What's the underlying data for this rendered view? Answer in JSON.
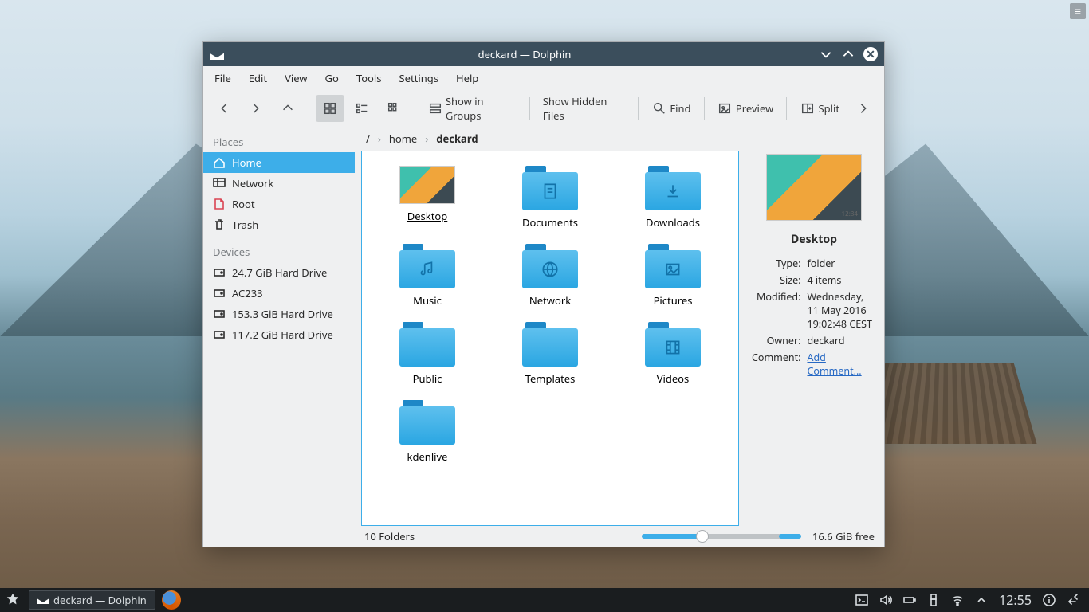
{
  "window": {
    "title": "deckard — Dolphin",
    "menus": [
      "File",
      "Edit",
      "View",
      "Go",
      "Tools",
      "Settings",
      "Help"
    ],
    "toolbar": {
      "show_groups": "Show in Groups",
      "show_hidden": "Show Hidden Files",
      "find": "Find",
      "preview": "Preview",
      "split": "Split"
    },
    "breadcrumbs": [
      "/",
      "home",
      "deckard"
    ]
  },
  "sidebar": {
    "places_header": "Places",
    "places": [
      {
        "label": "Home",
        "icon": "home",
        "selected": true
      },
      {
        "label": "Network",
        "icon": "network"
      },
      {
        "label": "Root",
        "icon": "root",
        "red": true
      },
      {
        "label": "Trash",
        "icon": "trash"
      }
    ],
    "devices_header": "Devices",
    "devices": [
      {
        "label": "24.7 GiB Hard Drive"
      },
      {
        "label": "AC233"
      },
      {
        "label": "153.3 GiB Hard Drive"
      },
      {
        "label": "117.2 GiB Hard Drive"
      }
    ]
  },
  "folders": [
    {
      "label": "Desktop",
      "type": "desktop",
      "selected": true
    },
    {
      "label": "Documents",
      "type": "doc"
    },
    {
      "label": "Downloads",
      "type": "down"
    },
    {
      "label": "Music",
      "type": "music"
    },
    {
      "label": "Network",
      "type": "globe"
    },
    {
      "label": "Pictures",
      "type": "pic"
    },
    {
      "label": "Public",
      "type": "plain"
    },
    {
      "label": "Templates",
      "type": "plain"
    },
    {
      "label": "Videos",
      "type": "video"
    },
    {
      "label": "kdenlive",
      "type": "plain"
    }
  ],
  "details": {
    "title": "Desktop",
    "rows": {
      "type_k": "Type:",
      "type_v": "folder",
      "size_k": "Size:",
      "size_v": "4 items",
      "mod_k": "Modified:",
      "mod_v": "Wednesday, 11 May 2016 19:02:48 CEST",
      "own_k": "Owner:",
      "own_v": "deckard",
      "com_k": "Comment:",
      "com_v": "Add Comment..."
    }
  },
  "status": {
    "left": "10 Folders",
    "right": "16.6 GiB free"
  },
  "taskbar": {
    "task": "deckard — Dolphin",
    "clock": "12:55"
  }
}
